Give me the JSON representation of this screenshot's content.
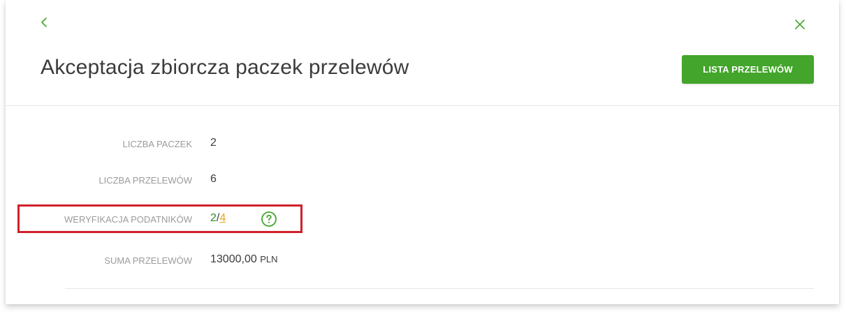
{
  "header": {
    "title": "Akceptacja zbiorcza paczek przelewów",
    "list_button_label": "LISTA PRZELEWÓW"
  },
  "icons": {
    "back": "chevron-left-icon",
    "close": "close-icon",
    "help": "question-circle-icon"
  },
  "summary": {
    "packages": {
      "label": "LICZBA PACZEK",
      "value": "2"
    },
    "transfers": {
      "label": "LICZBA PRZELEWÓW",
      "value": "6"
    },
    "taxpayer_verification": {
      "label": "WERYFIKACJA PODATNIKÓW",
      "verified": "2",
      "separator": "/",
      "total": "4"
    },
    "sum": {
      "label": "SUMA PRZELEWÓW",
      "amount": "13000,00",
      "currency": "PLN"
    }
  },
  "colors": {
    "accent_green": "#43a52b",
    "link_orange": "#e6a21a",
    "highlight_red": "#d0202a",
    "label_gray": "#9b9b9b",
    "text_dark": "#3b3b3b"
  }
}
